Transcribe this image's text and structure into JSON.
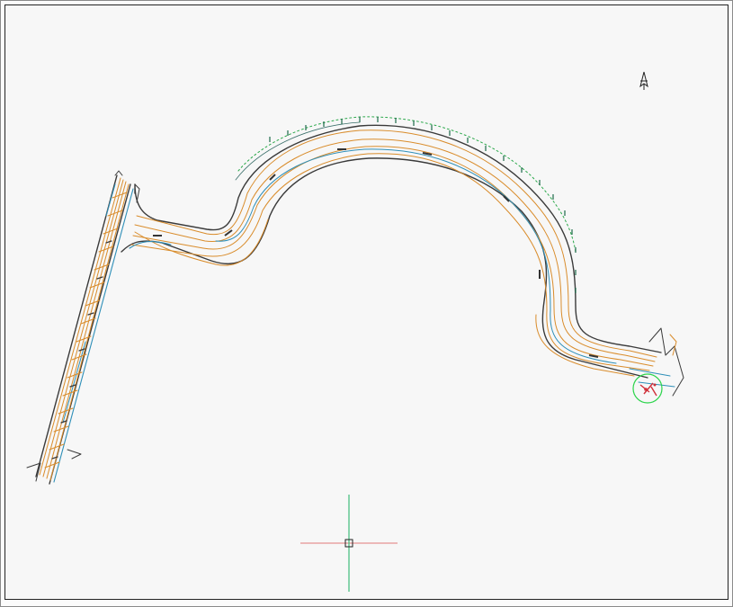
{
  "window": {
    "title": ""
  },
  "drawing": {
    "background": "#f7f7f7",
    "frame_color": "#222222",
    "layers": [
      {
        "name": "contours-orange",
        "color": "#d98c2b"
      },
      {
        "name": "water-blue",
        "color": "#2e8fb8"
      },
      {
        "name": "edge-dark",
        "color": "#3a3a3a"
      },
      {
        "name": "vegetation-green",
        "color": "#2aa84a"
      },
      {
        "name": "marker-red",
        "color": "#d0303a"
      }
    ],
    "north_arrow_icon": "north-arrow-icon",
    "survey_marker_icon": "survey-circle-marker-icon"
  },
  "cursor": {
    "icon": "crosshair-cursor-icon",
    "horizontal_color": "#e07a7a",
    "vertical_color": "#3dbb7a"
  }
}
